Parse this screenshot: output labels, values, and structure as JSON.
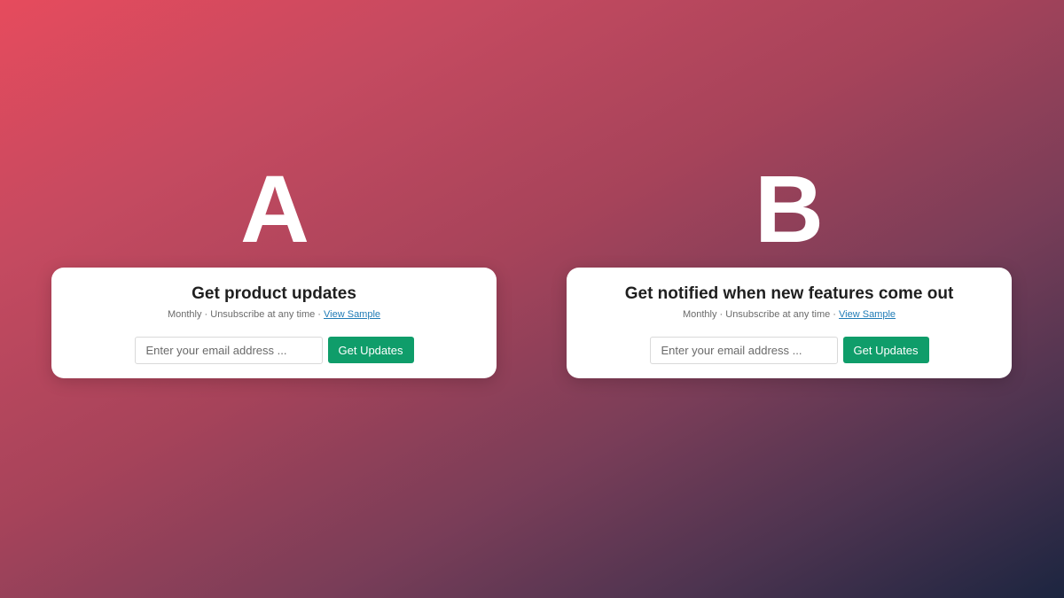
{
  "variants": {
    "a": {
      "letter": "A",
      "title": "Get product updates",
      "subtitle": "Monthly · Unsubscribe at any time · ",
      "link": "View Sample",
      "input_placeholder": "Enter your email address ...",
      "button": "Get Updates"
    },
    "b": {
      "letter": "B",
      "title": "Get notified when new features come out",
      "subtitle": "Monthly · Unsubscribe at any time · ",
      "link": "View Sample",
      "input_placeholder": "Enter your email address ...",
      "button": "Get Updates"
    }
  },
  "colors": {
    "button_bg": "#0f9d6a",
    "link": "#1f7bb6",
    "background_start": "#e64b5d",
    "background_end": "#1c2540"
  }
}
